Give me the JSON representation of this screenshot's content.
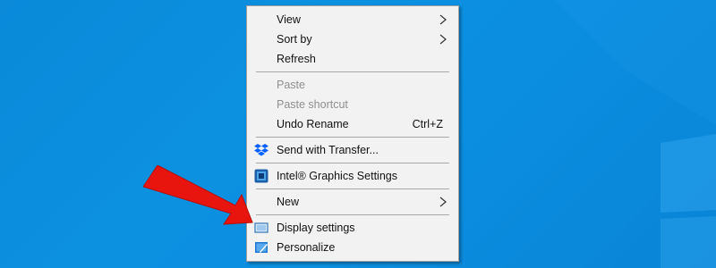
{
  "colors": {
    "desktop_bg": "#0c8de0",
    "menu_bg": "#f2f2f2",
    "disabled_text": "#8f8f8f",
    "arrow": "#e8150f"
  },
  "menu": {
    "view": {
      "label": "View",
      "has_submenu": true
    },
    "sort_by": {
      "label": "Sort by",
      "has_submenu": true
    },
    "refresh": {
      "label": "Refresh"
    },
    "paste": {
      "label": "Paste",
      "disabled": true
    },
    "paste_shortcut": {
      "label": "Paste shortcut",
      "disabled": true
    },
    "undo_rename": {
      "label": "Undo Rename",
      "shortcut": "Ctrl+Z"
    },
    "send_transfer": {
      "label": "Send with Transfer...",
      "icon": "dropbox-icon"
    },
    "intel_graphics": {
      "label": "Intel® Graphics Settings",
      "icon": "intel-graphics-icon"
    },
    "new": {
      "label": "New",
      "has_submenu": true
    },
    "display_settings": {
      "label": "Display settings",
      "icon": "display-icon"
    },
    "personalize": {
      "label": "Personalize",
      "icon": "personalize-icon"
    }
  },
  "annotation": {
    "icon": "red-arrow-icon",
    "points_to": "Display settings"
  }
}
